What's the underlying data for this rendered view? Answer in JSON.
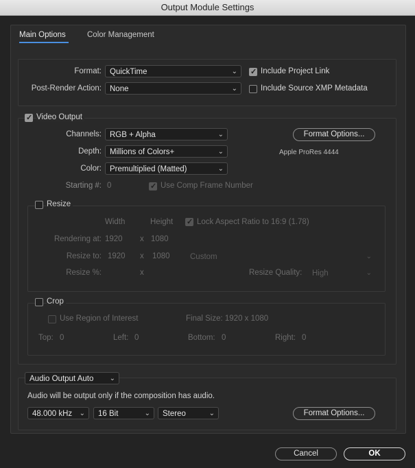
{
  "window": {
    "title": "Output Module Settings"
  },
  "tabs": [
    {
      "label": "Main Options",
      "active": true
    },
    {
      "label": "Color Management",
      "active": false
    }
  ],
  "format": {
    "label": "Format:",
    "value": "QuickTime",
    "post_render_label": "Post-Render Action:",
    "post_render_value": "None",
    "include_project_link": {
      "label": "Include Project Link",
      "checked": true
    },
    "include_xmp": {
      "label": "Include Source XMP Metadata",
      "checked": false
    }
  },
  "video": {
    "label": "Video Output",
    "checked": true,
    "channels_label": "Channels:",
    "channels_value": "RGB + Alpha",
    "depth_label": "Depth:",
    "depth_value": "Millions of Colors+",
    "color_label": "Color:",
    "color_value": "Premultiplied (Matted)",
    "starting_label": "Starting #:",
    "starting_value": "0",
    "use_comp_frame": {
      "label": "Use Comp Frame Number",
      "checked": true
    },
    "format_options_label": "Format Options...",
    "codec_text": "Apple ProRes 4444"
  },
  "resize": {
    "label": "Resize",
    "checked": false,
    "width_header": "Width",
    "height_header": "Height",
    "lock_aspect": {
      "label": "Lock Aspect Ratio to 16:9 (1.78)",
      "checked": true
    },
    "rendering_label": "Rendering at:",
    "rendering_w": "1920",
    "rendering_h": "1080",
    "resize_to_label": "Resize to:",
    "resize_to_w": "1920",
    "resize_to_h": "1080",
    "times": "x",
    "preset_value": "Custom",
    "resize_pct_label": "Resize %:",
    "quality_label": "Resize Quality:",
    "quality_value": "High"
  },
  "crop": {
    "label": "Crop",
    "checked": false,
    "roi": {
      "label": "Use Region of Interest",
      "checked": false
    },
    "final_size": "Final Size: 1920 x 1080",
    "top_label": "Top:",
    "top_value": "0",
    "left_label": "Left:",
    "left_value": "0",
    "bottom_label": "Bottom:",
    "bottom_value": "0",
    "right_label": "Right:",
    "right_value": "0"
  },
  "audio": {
    "mode_value": "Audio Output Auto",
    "note": "Audio will be output only if the composition has audio.",
    "rate_value": "48.000 kHz",
    "bits_value": "16 Bit",
    "channels_value": "Stereo",
    "format_options_label": "Format Options..."
  },
  "footer": {
    "cancel_label": "Cancel",
    "ok_label": "OK"
  },
  "icons": {
    "chevron": "chevron-down-icon",
    "check": "checkmark-icon"
  },
  "colors": {
    "accent": "#4a8fe0",
    "background": "#232323"
  }
}
